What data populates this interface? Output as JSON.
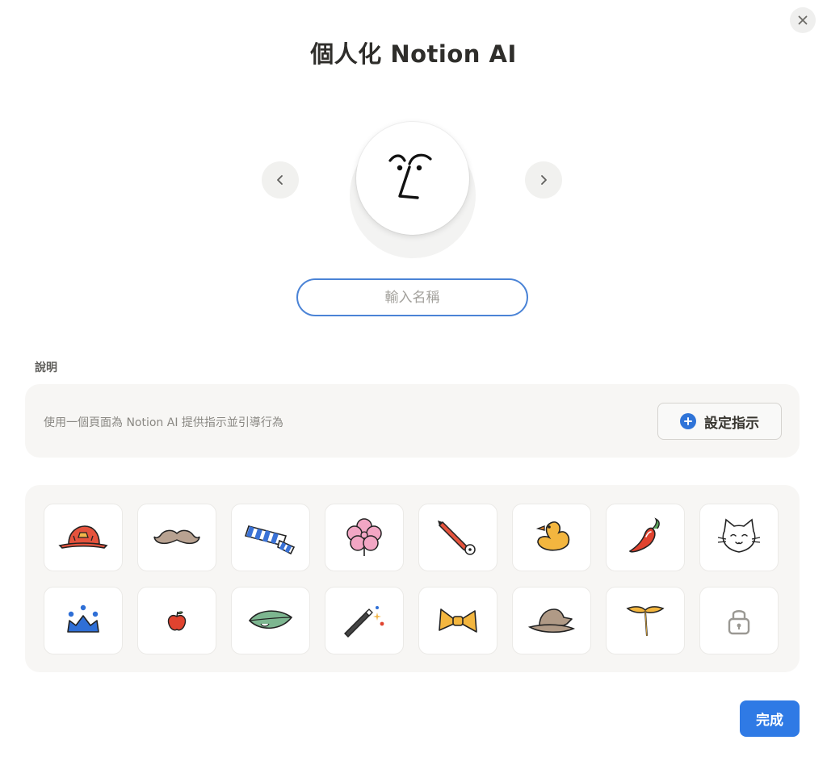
{
  "dialog": {
    "title": "個人化 Notion AI",
    "close_icon": "close-icon"
  },
  "avatar": {
    "prev_icon": "chevron-left-icon",
    "next_icon": "chevron-right-icon",
    "face_icon": "ai-face-icon"
  },
  "name_input": {
    "value": "",
    "placeholder": "輸入名稱"
  },
  "description": {
    "label": "說明",
    "text": "使用一個頁面為 Notion AI 提供指示並引導行為",
    "button_label": "設定指示",
    "button_icon": "plus-circle-icon"
  },
  "accessories": [
    {
      "name": "red-hat-icon",
      "locked": false
    },
    {
      "name": "mustache-icon",
      "locked": false
    },
    {
      "name": "striped-scarf-icon",
      "locked": false
    },
    {
      "name": "flower-icon",
      "locked": false
    },
    {
      "name": "pencil-icon",
      "locked": false
    },
    {
      "name": "duck-icon",
      "locked": false
    },
    {
      "name": "chili-pepper-icon",
      "locked": false
    },
    {
      "name": "cat-face-icon",
      "locked": false
    },
    {
      "name": "blue-crown-icon",
      "locked": false
    },
    {
      "name": "apple-icon",
      "locked": false
    },
    {
      "name": "leaf-icon",
      "locked": false
    },
    {
      "name": "magic-wand-icon",
      "locked": false
    },
    {
      "name": "bow-tie-icon",
      "locked": false
    },
    {
      "name": "witch-hat-icon",
      "locked": false
    },
    {
      "name": "propeller-icon",
      "locked": false
    },
    {
      "name": "lock-icon",
      "locked": true
    }
  ],
  "footer": {
    "done_label": "完成"
  },
  "colors": {
    "accent": "#2f7ae5",
    "input_border": "#4a83d6",
    "panel_bg": "#f7f6f4"
  }
}
